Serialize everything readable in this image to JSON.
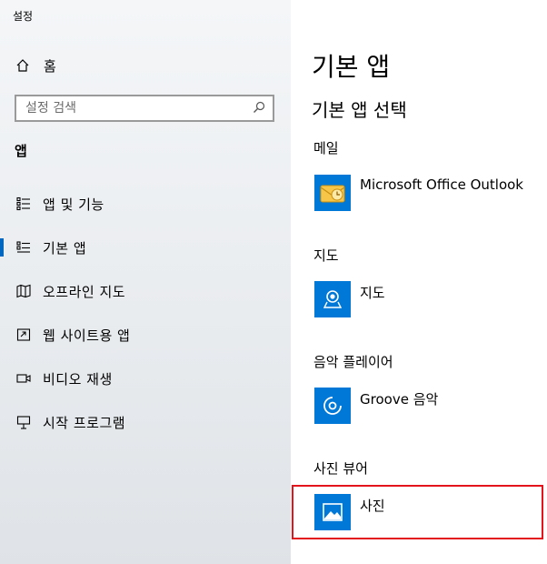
{
  "window": {
    "title": "설정"
  },
  "sidebar": {
    "home_label": "홈",
    "search_placeholder": "설정 검색",
    "section_title": "앱",
    "items": [
      {
        "label": "앱 및 기능",
        "icon": "apps-features-icon",
        "selected": false
      },
      {
        "label": "기본 앱",
        "icon": "default-apps-icon",
        "selected": true
      },
      {
        "label": "오프라인 지도",
        "icon": "offline-maps-icon",
        "selected": false
      },
      {
        "label": "웹 사이트용 앱",
        "icon": "apps-for-websites-icon",
        "selected": false
      },
      {
        "label": "비디오 재생",
        "icon": "video-playback-icon",
        "selected": false
      },
      {
        "label": "시작 프로그램",
        "icon": "startup-icon",
        "selected": false
      }
    ]
  },
  "main": {
    "title": "기본 앱",
    "subtitle": "기본 앱 선택",
    "groups": [
      {
        "label": "메일",
        "app": "Microsoft Office Outlook",
        "icon": "outlook-icon"
      },
      {
        "label": "지도",
        "app": "지도",
        "icon": "maps-app-icon"
      },
      {
        "label": "음악 플레이어",
        "app": "Groove 음악",
        "icon": "groove-music-icon"
      },
      {
        "label": "사진 뷰어",
        "app": "사진",
        "icon": "photos-app-icon"
      }
    ]
  },
  "colors": {
    "accent": "#0078d7",
    "indicator": "#0067c0",
    "highlight": "#e3141b"
  }
}
